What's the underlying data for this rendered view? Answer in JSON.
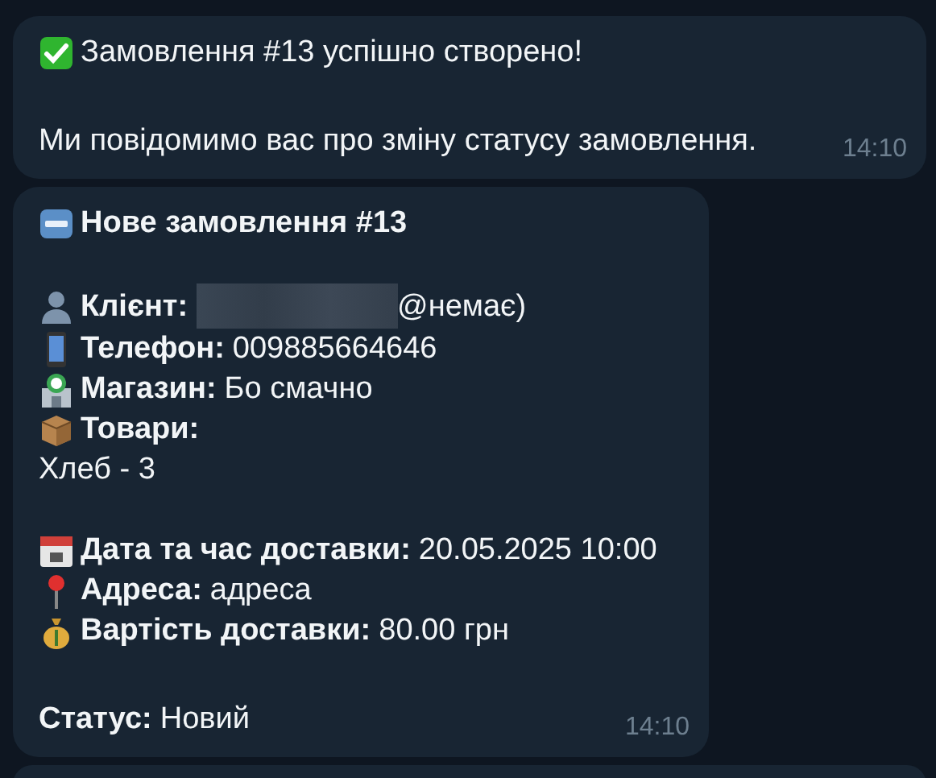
{
  "messages": [
    {
      "time": "14:10",
      "paragraphs": [
        [
          {
            "kind": "check",
            "value": "Замовлення #13 успішно створено!"
          }
        ],
        [
          {
            "value": "Ми повідомимо вас про зміну статусу замовлення."
          }
        ]
      ]
    },
    {
      "time": "14:10",
      "paragraphs": [
        [
          {
            "kind": "new",
            "label": "Нове замовлення #13"
          }
        ],
        [
          {
            "kind": "person",
            "label": "Клієнт:",
            "redacted": true,
            "value": "@немає)"
          },
          {
            "kind": "phone",
            "label": "Телефон:",
            "value": "009885664646"
          },
          {
            "kind": "store",
            "label": "Магазин:",
            "value": "Бо смачно"
          },
          {
            "kind": "box",
            "label": "Товари:"
          },
          {
            "value": "Хлеб - 3"
          }
        ],
        [
          {
            "kind": "calendar",
            "label": "Дата та час доставки:",
            "value": "20.05.2025 10:00"
          },
          {
            "kind": "pin",
            "label": "Адреса:",
            "value": "адреса"
          },
          {
            "kind": "moneybag",
            "label": "Вартість доставки:",
            "value": "80.00 грн"
          }
        ],
        [
          {
            "label": "Статус:",
            "value": "Новий"
          }
        ]
      ]
    }
  ]
}
